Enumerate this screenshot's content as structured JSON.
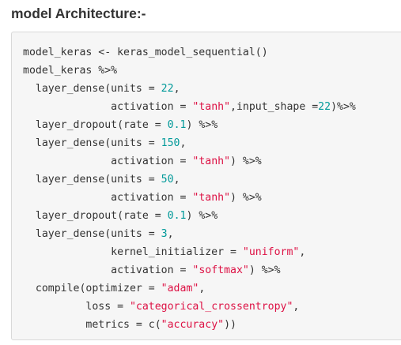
{
  "heading": "model Architecture:-",
  "code": {
    "lines": [
      [
        {
          "t": "plain",
          "v": "model_keras <- keras_model_sequential()"
        }
      ],
      [
        {
          "t": "plain",
          "v": "model_keras %>%"
        }
      ],
      [
        {
          "t": "plain",
          "v": "  layer_dense(units = "
        },
        {
          "t": "num",
          "v": "22"
        },
        {
          "t": "plain",
          "v": ","
        }
      ],
      [
        {
          "t": "plain",
          "v": "              activation = "
        },
        {
          "t": "str",
          "v": "\"tanh\""
        },
        {
          "t": "plain",
          "v": ",input_shape ="
        },
        {
          "t": "num",
          "v": "22"
        },
        {
          "t": "plain",
          "v": ")%>%"
        }
      ],
      [
        {
          "t": "plain",
          "v": "  layer_dropout(rate = "
        },
        {
          "t": "num",
          "v": "0.1"
        },
        {
          "t": "plain",
          "v": ") %>%"
        }
      ],
      [
        {
          "t": "plain",
          "v": "  layer_dense(units = "
        },
        {
          "t": "num",
          "v": "150"
        },
        {
          "t": "plain",
          "v": ","
        }
      ],
      [
        {
          "t": "plain",
          "v": "              activation = "
        },
        {
          "t": "str",
          "v": "\"tanh\""
        },
        {
          "t": "plain",
          "v": ") %>%"
        }
      ],
      [
        {
          "t": "plain",
          "v": "  layer_dense(units = "
        },
        {
          "t": "num",
          "v": "50"
        },
        {
          "t": "plain",
          "v": ","
        }
      ],
      [
        {
          "t": "plain",
          "v": "              activation = "
        },
        {
          "t": "str",
          "v": "\"tanh\""
        },
        {
          "t": "plain",
          "v": ") %>%"
        }
      ],
      [
        {
          "t": "plain",
          "v": "  layer_dropout(rate = "
        },
        {
          "t": "num",
          "v": "0.1"
        },
        {
          "t": "plain",
          "v": ") %>%"
        }
      ],
      [
        {
          "t": "plain",
          "v": "  layer_dense(units = "
        },
        {
          "t": "num",
          "v": "3"
        },
        {
          "t": "plain",
          "v": ","
        }
      ],
      [
        {
          "t": "plain",
          "v": "              kernel_initializer = "
        },
        {
          "t": "str",
          "v": "\"uniform\""
        },
        {
          "t": "plain",
          "v": ","
        }
      ],
      [
        {
          "t": "plain",
          "v": "              activation = "
        },
        {
          "t": "str",
          "v": "\"softmax\""
        },
        {
          "t": "plain",
          "v": ") %>%"
        }
      ],
      [
        {
          "t": "plain",
          "v": "  compile(optimizer = "
        },
        {
          "t": "str",
          "v": "\"adam\""
        },
        {
          "t": "plain",
          "v": ","
        }
      ],
      [
        {
          "t": "plain",
          "v": "          loss = "
        },
        {
          "t": "str",
          "v": "\"categorical_crossentropy\""
        },
        {
          "t": "plain",
          "v": ","
        }
      ],
      [
        {
          "t": "plain",
          "v": "          metrics = c("
        },
        {
          "t": "str",
          "v": "\"accuracy\""
        },
        {
          "t": "plain",
          "v": "))"
        }
      ]
    ]
  },
  "colors": {
    "number": "#009999",
    "string": "#dd1144",
    "text": "#333333",
    "code_background": "#f6f6f6"
  }
}
